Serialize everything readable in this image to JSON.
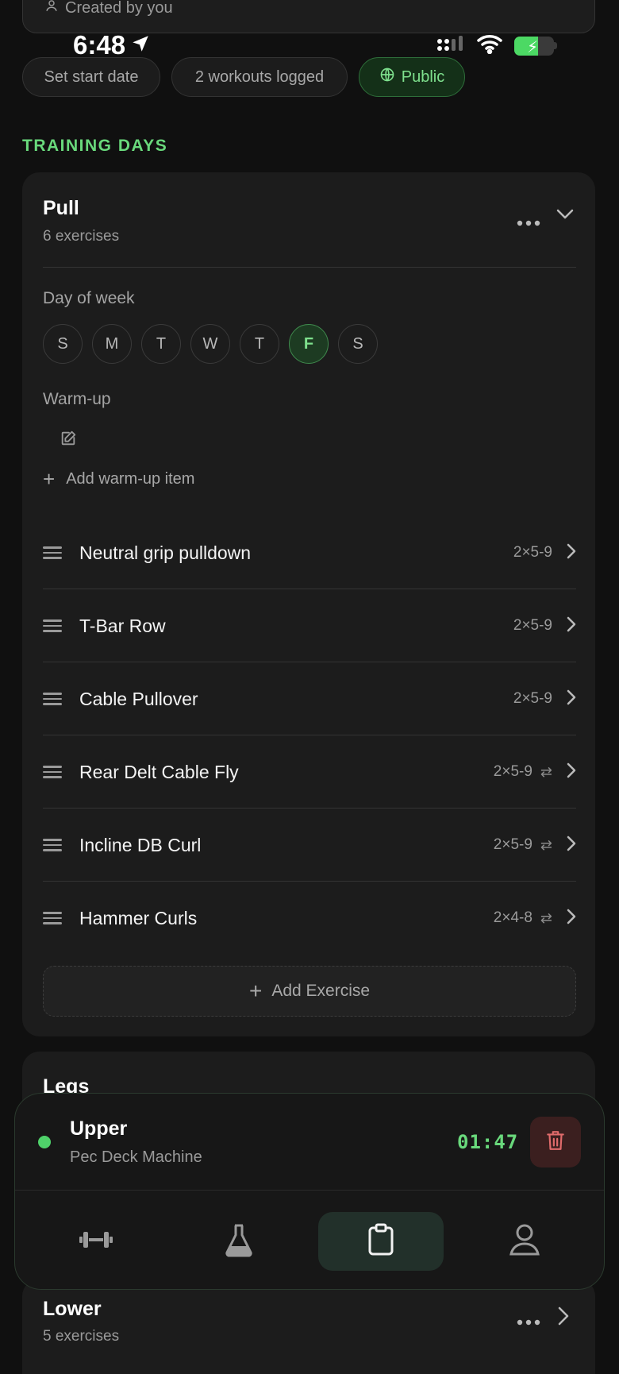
{
  "header": {
    "created_by": "Created by you"
  },
  "status_bar": {
    "time": "6:48"
  },
  "chips": {
    "start_date": "Set start date",
    "logged": "2 workouts logged",
    "visibility": "Public"
  },
  "section_title": "TRAINING DAYS",
  "day_card": {
    "title": "Pull",
    "subtitle": "6 exercises",
    "day_of_week_label": "Day of week",
    "days": [
      "S",
      "M",
      "T",
      "W",
      "T",
      "F",
      "S"
    ],
    "selected_day_index": 5,
    "warmup_label": "Warm-up",
    "add_warmup": "Add warm-up item",
    "exercises": [
      {
        "name": "Neutral grip pulldown",
        "scheme": "2×5-9",
        "swap": false
      },
      {
        "name": "T-Bar Row",
        "scheme": "2×5-9",
        "swap": false
      },
      {
        "name": "Cable Pullover",
        "scheme": "2×5-9",
        "swap": false
      },
      {
        "name": "Rear Delt Cable Fly",
        "scheme": "2×5-9",
        "swap": true
      },
      {
        "name": "Incline DB Curl",
        "scheme": "2×5-9",
        "swap": true
      },
      {
        "name": "Hammer Curls",
        "scheme": "2×4-8",
        "swap": true
      }
    ],
    "add_exercise": "Add Exercise"
  },
  "legs_card": {
    "title": "Legs"
  },
  "session": {
    "title": "Upper",
    "subtitle": "Pec Deck Machine",
    "timer": "01:47"
  },
  "nav": {
    "items": [
      "workouts-icon",
      "lab-icon",
      "program-icon",
      "profile-icon"
    ],
    "active_index": 2
  },
  "lower_card": {
    "title": "Lower",
    "subtitle": "5 exercises"
  },
  "colors": {
    "accent": "#69d97c",
    "background": "#101010",
    "card": "#1c1c1c"
  }
}
